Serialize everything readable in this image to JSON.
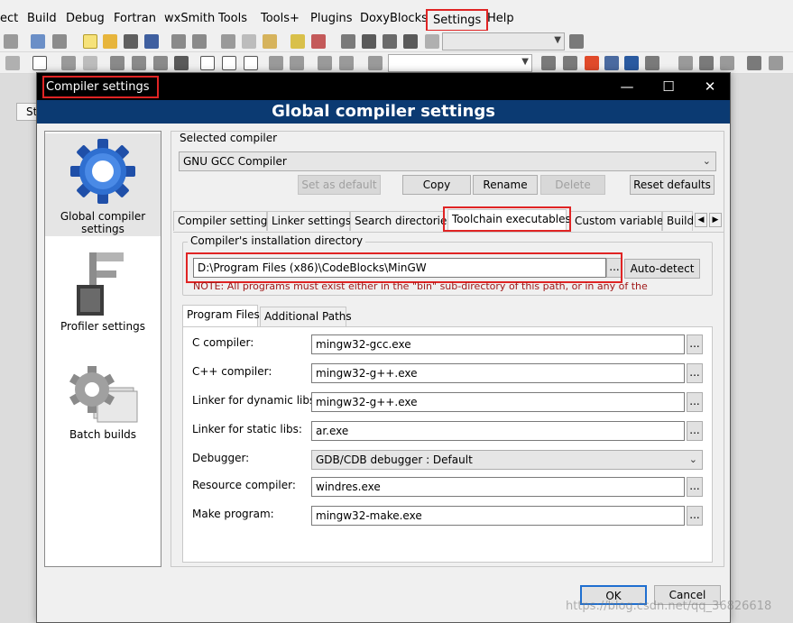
{
  "menubar": {
    "items": [
      "ect",
      "Build",
      "Debug",
      "Fortran",
      "wxSmith",
      "Tools",
      "Tools+",
      "Plugins",
      "DoxyBlocks",
      "Settings",
      "Help"
    ]
  },
  "side_tab_stub": "St",
  "dialog": {
    "title": "Compiler settings",
    "banner": "Global compiler settings",
    "window_buttons": {
      "minimize": "—",
      "maximize": "☐",
      "close": "✕"
    },
    "sidebar": [
      {
        "label": "Global compiler settings",
        "icon": "gear-icon"
      },
      {
        "label": "Profiler settings",
        "icon": "caliper-icon"
      },
      {
        "label": "Batch builds",
        "icon": "batch-gear-icon"
      }
    ],
    "selected_compiler": {
      "group_label": "Selected compiler",
      "value": "GNU GCC Compiler",
      "buttons": {
        "set_default": "Set as default",
        "copy": "Copy",
        "rename": "Rename",
        "delete": "Delete",
        "reset": "Reset defaults"
      }
    },
    "tabs": [
      "Compiler settings",
      "Linker settings",
      "Search directories",
      "Toolchain executables",
      "Custom variables",
      "Build"
    ],
    "install_dir": {
      "group_label": "Compiler's installation directory",
      "value": "D:\\Program Files (x86)\\CodeBlocks\\MinGW",
      "browse": "...",
      "autodetect": "Auto-detect",
      "note": "NOTE: All programs must exist either in the \"bin\" sub-directory of this path, or in any of the"
    },
    "subtabs": [
      "Program Files",
      "Additional Paths"
    ],
    "programs": [
      {
        "label": "C compiler:",
        "value": "mingw32-gcc.exe"
      },
      {
        "label": "C++ compiler:",
        "value": "mingw32-g++.exe"
      },
      {
        "label": "Linker for dynamic libs:",
        "value": "mingw32-g++.exe"
      },
      {
        "label": "Linker for static libs:",
        "value": "ar.exe"
      },
      {
        "label": "Debugger:",
        "value": "GDB/CDB debugger : Default"
      },
      {
        "label": "Resource compiler:",
        "value": "windres.exe"
      },
      {
        "label": "Make program:",
        "value": "mingw32-make.exe"
      }
    ],
    "browse_label": "...",
    "ok": "OK",
    "cancel": "Cancel",
    "watermark": "https://blog.csdn.net/qq_36826618"
  }
}
